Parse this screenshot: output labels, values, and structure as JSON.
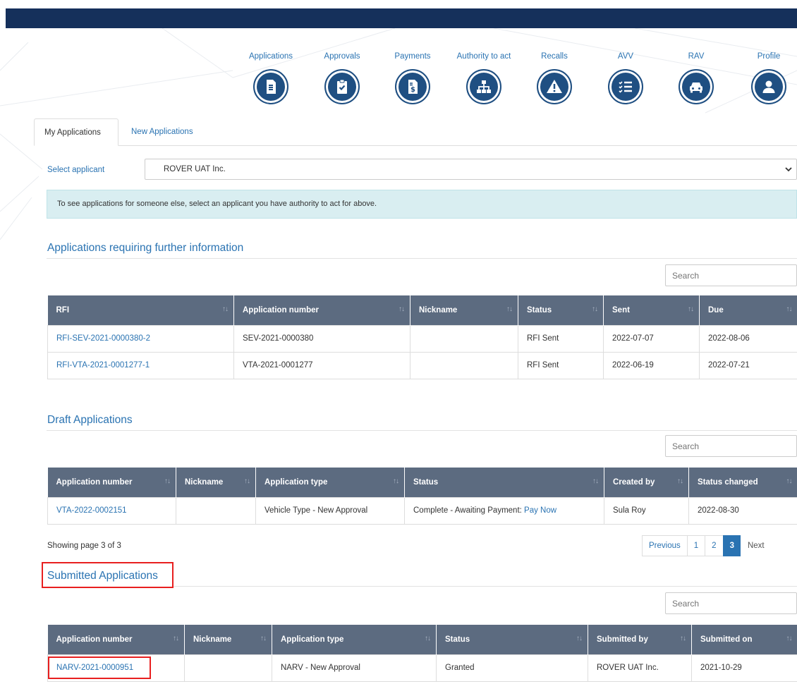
{
  "nav": [
    {
      "label": "Applications",
      "icon": "document-icon"
    },
    {
      "label": "Approvals",
      "icon": "clipboard-check-icon"
    },
    {
      "label": "Payments",
      "icon": "invoice-dollar-icon"
    },
    {
      "label": "Authority to act",
      "icon": "org-chart-icon"
    },
    {
      "label": "Recalls",
      "icon": "warning-icon"
    },
    {
      "label": "AVV",
      "icon": "checklist-icon"
    },
    {
      "label": "RAV",
      "icon": "car-icon"
    },
    {
      "label": "Profile",
      "icon": "user-icon"
    }
  ],
  "tabs": {
    "my": "My Applications",
    "new": "New Applications"
  },
  "applicant": {
    "label": "Select applicant",
    "value": "ROVER UAT Inc."
  },
  "info_text": "To see applications for someone else, select an applicant you have authority to act for above.",
  "search_placeholder": "Search",
  "rfi": {
    "title": "Applications requiring further information",
    "headers": [
      "RFI",
      "Application number",
      "Nickname",
      "Status",
      "Sent",
      "Due"
    ],
    "rows": [
      [
        "RFI-SEV-2021-0000380-2",
        "SEV-2021-0000380",
        "",
        "RFI Sent",
        "2022-07-07",
        "2022-08-06"
      ],
      [
        "RFI-VTA-2021-0001277-1",
        "VTA-2021-0001277",
        "",
        "RFI Sent",
        "2022-06-19",
        "2022-07-21"
      ]
    ]
  },
  "draft": {
    "title": "Draft Applications",
    "headers": [
      "Application number",
      "Nickname",
      "Application type",
      "Status",
      "Created by",
      "Status changed"
    ],
    "row": {
      "number": "VTA-2022-0002151",
      "nickname": "",
      "type": "Vehicle Type - New Approval",
      "status": "Complete - Awaiting Payment: ",
      "pay_link": "Pay Now",
      "created_by": "Sula Roy",
      "changed": "2022-08-30"
    },
    "showing": "Showing page 3 of 3",
    "pager": {
      "previous": "Previous",
      "pages": [
        "1",
        "2",
        "3"
      ],
      "current": "3",
      "next": "Next"
    }
  },
  "submitted": {
    "title": "Submitted Applications",
    "headers": [
      "Application number",
      "Nickname",
      "Application type",
      "Status",
      "Submitted by",
      "Submitted on"
    ],
    "rows": [
      [
        "NARV-2021-0000951",
        "",
        "NARV - New Approval",
        "Granted",
        "ROVER UAT Inc.",
        "2021-10-29"
      ]
    ]
  },
  "colors": {
    "header_bar": "#15305b",
    "link": "#2a73b2",
    "table_header": "#5c6b80",
    "highlight": "#e81f1f",
    "info_bg": "#d9eef1"
  }
}
